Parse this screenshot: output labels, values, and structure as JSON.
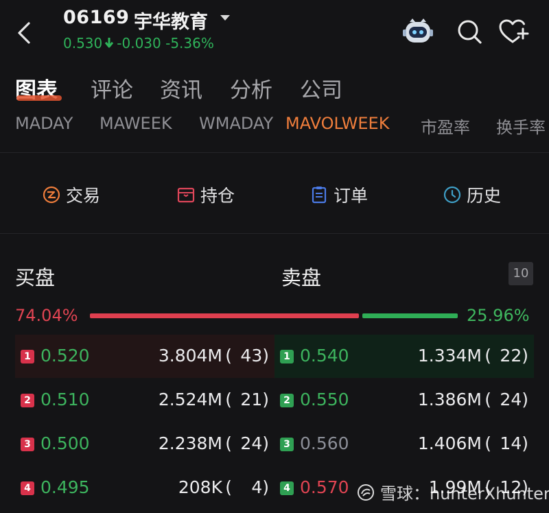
{
  "header": {
    "code": "06169",
    "name": "宇华教育",
    "price": "0.530",
    "change": "-0.030",
    "change_pct": "-5.36%",
    "quote_color": "#2fb35a"
  },
  "main_tabs": [
    {
      "label": "图表",
      "active": true
    },
    {
      "label": "评论",
      "active": false
    },
    {
      "label": "资讯",
      "active": false
    },
    {
      "label": "分析",
      "active": false
    },
    {
      "label": "公司",
      "active": false
    }
  ],
  "indicator_tabs": [
    {
      "label": "MADAY",
      "active": false
    },
    {
      "label": "MAWEEK",
      "active": false
    },
    {
      "label": "WMADAY",
      "active": false
    },
    {
      "label": "MAVOLWEEK",
      "active": true
    },
    {
      "label": "市盈率",
      "active": false
    },
    {
      "label": "换手率",
      "active": false
    }
  ],
  "actions": [
    {
      "label": "交易",
      "icon": "trade-icon",
      "color": "#f07e3c"
    },
    {
      "label": "持仓",
      "icon": "position-icon",
      "color": "#e0465a"
    },
    {
      "label": "订单",
      "icon": "order-icon",
      "color": "#4b7be8"
    },
    {
      "label": "历史",
      "icon": "history-icon",
      "color": "#3fa0c8"
    }
  ],
  "order_book": {
    "buy_title": "买盘",
    "sell_title": "卖盘",
    "depth": "10",
    "buy_pct": "74.04%",
    "sell_pct": "25.96%",
    "buy_ratio": 0.7404,
    "bids": [
      {
        "level": "1",
        "price": "0.520",
        "volume": "3.804M",
        "count": "43"
      },
      {
        "level": "2",
        "price": "0.510",
        "volume": "2.524M",
        "count": "21"
      },
      {
        "level": "3",
        "price": "0.500",
        "volume": "2.238M",
        "count": "24"
      },
      {
        "level": "4",
        "price": "0.495",
        "volume": "208K",
        "count": "4"
      }
    ],
    "asks": [
      {
        "level": "1",
        "price": "0.540",
        "volume": "1.334M",
        "count": "22"
      },
      {
        "level": "2",
        "price": "0.550",
        "volume": "1.386M",
        "count": "24"
      },
      {
        "level": "3",
        "price": "0.560",
        "volume": "1.406M",
        "count": "14"
      },
      {
        "level": "4",
        "price": "0.570",
        "volume": "1.99M",
        "count": "12"
      }
    ]
  },
  "watermark": "雪球：hunterXhunter"
}
